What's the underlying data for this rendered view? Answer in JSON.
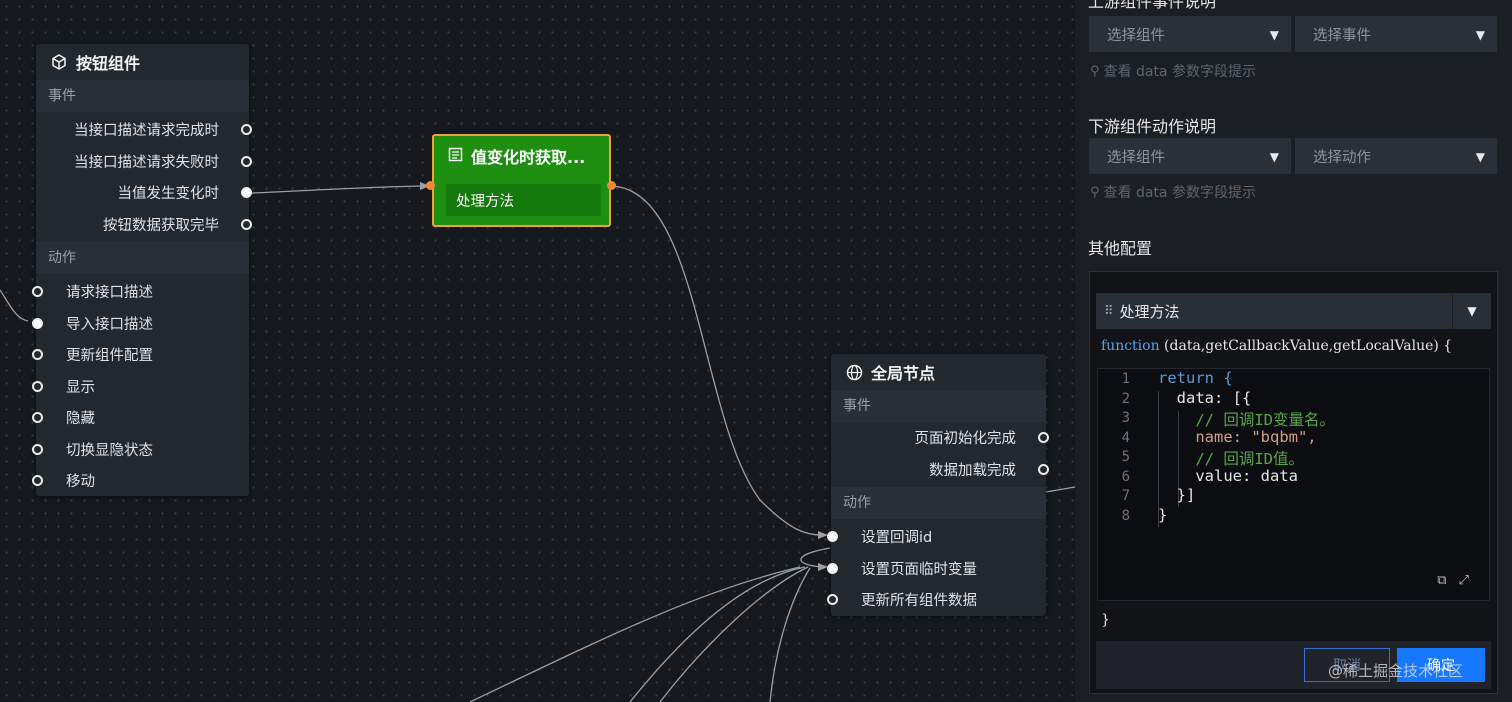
{
  "canvas": {
    "button_node": {
      "title": "按钮组件",
      "events_label": "事件",
      "events": [
        "当接口描述请求完成时",
        "当接口描述请求失败时",
        "当值发生变化时",
        "按钮数据获取完毕"
      ],
      "actions_label": "动作",
      "actions": [
        "请求接口描述",
        "导入接口描述",
        "更新组件配置",
        "显示",
        "隐藏",
        "切换显隐状态",
        "移动"
      ]
    },
    "handler_node": {
      "title": "值变化时获取...",
      "item": "处理方法"
    },
    "global_node": {
      "title": "全局节点",
      "events_label": "事件",
      "events": [
        "页面初始化完成",
        "数据加载完成"
      ],
      "actions_label": "动作",
      "actions": [
        "设置回调id",
        "设置页面临时变量",
        "更新所有组件数据"
      ]
    }
  },
  "panel": {
    "upstream_title": "上游组件事件说明",
    "upstream_select_component": "选择组件",
    "upstream_select_event": "选择事件",
    "upstream_hint": "查看 data 参数字段提示",
    "downstream_title": "下游组件动作说明",
    "downstream_select_component": "选择组件",
    "downstream_select_action": "选择动作",
    "downstream_hint": "查看 data 参数字段提示",
    "other_title": "其他配置",
    "editor_title": "处理方法",
    "fn_keyword": "function",
    "fn_signature": " (data,getCallbackValue,getLocalValue) {",
    "code_lines": [
      "return {",
      "  data: [{",
      "    // 回调ID变量名。",
      "    name: \"bqbm\",",
      "    // 回调ID值。",
      "    value: data",
      "  }]",
      "}"
    ],
    "line_numbers": [
      "1",
      "2",
      "3",
      "4",
      "5",
      "6",
      "7",
      "8"
    ],
    "close_brace": "}",
    "cancel_label": "取消",
    "ok_label": "确定",
    "watermark": "@稀土掘金技术社区"
  },
  "colors": {
    "canvas_bg": "#15181c",
    "node_bg": "#23272e",
    "handler_green": "#1f8f12",
    "handler_border": "#f0a040",
    "port_orange": "#f08a3a",
    "primary_blue": "#1677ff"
  }
}
